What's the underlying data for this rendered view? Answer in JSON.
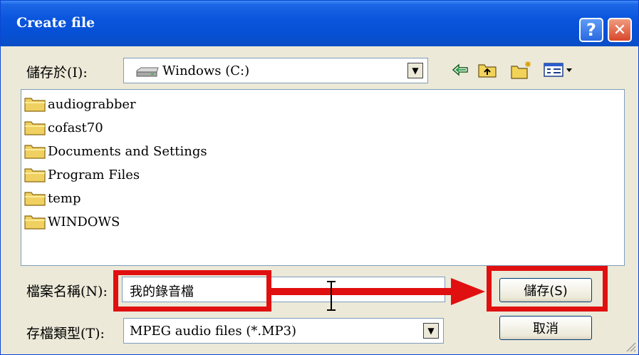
{
  "window": {
    "title": "Create file"
  },
  "titlebar": {
    "help_glyph": "?",
    "close_glyph": "✕"
  },
  "save_in": {
    "label": "儲存於(I):",
    "value": "Windows (C:)",
    "drive_icon": "hard-drive-icon",
    "dropdown_glyph": "▼"
  },
  "toolbar": [
    "back-arrow-icon",
    "up-folder-icon",
    "new-folder-icon",
    "view-menu-icon"
  ],
  "files": [
    "audiograbber",
    "cofast70",
    "Documents and Settings",
    "Program Files",
    "temp",
    "WINDOWS"
  ],
  "file_name": {
    "label": "檔案名稱(N):",
    "value": "我的錄音檔"
  },
  "save_type": {
    "label": "存檔類型(T):",
    "value": "MPEG audio files (*.MP3)",
    "dropdown_glyph": "▼"
  },
  "buttons": {
    "save": "儲存(S)",
    "cancel": "取消"
  },
  "colors": {
    "highlight": "#e01010",
    "titlebar": "#0a55dc",
    "face": "#ece9d8"
  }
}
